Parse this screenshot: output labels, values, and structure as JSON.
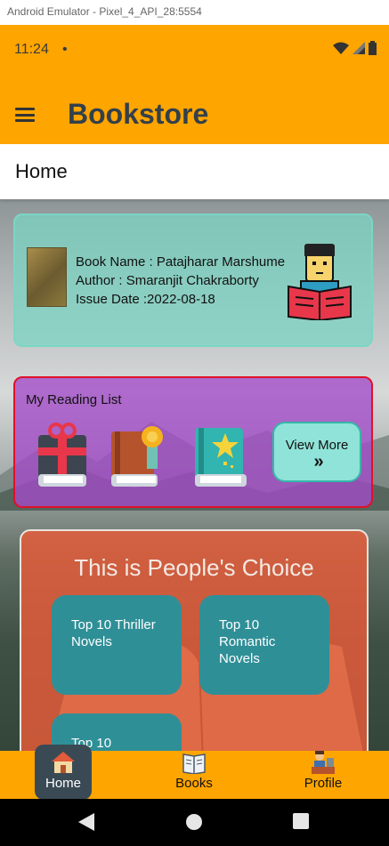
{
  "window": {
    "title": "Android Emulator - Pixel_4_API_28:5554"
  },
  "status_bar": {
    "time": "11:24",
    "dot": "•"
  },
  "app_bar": {
    "title": "Bookstore"
  },
  "page": {
    "title": "Home"
  },
  "featured_book": {
    "name_line": "Book Name : Patajharar Marshume",
    "author_line": "Author : Smaranjit Chakraborty",
    "date_line": "Issue Date :2022-08-18"
  },
  "reading_list": {
    "title": "My Reading List",
    "view_more_label": "View More",
    "view_more_arrow": "»"
  },
  "peoples_choice": {
    "title": "This is People's Choice",
    "tiles": [
      {
        "label": "Top 10 Thriller Novels"
      },
      {
        "label": "Top 10 Romantic Novels"
      },
      {
        "label": "Top 10"
      }
    ]
  },
  "bottom_nav": {
    "items": [
      {
        "label": "Home",
        "icon": "house-icon"
      },
      {
        "label": "Books",
        "icon": "book-icon"
      },
      {
        "label": "Profile",
        "icon": "person-desk-icon"
      }
    ]
  },
  "colors": {
    "accent": "#FFA500",
    "tile": "#2F8F97",
    "reading_list": "#A34AC8",
    "choice": "#E85C38"
  }
}
